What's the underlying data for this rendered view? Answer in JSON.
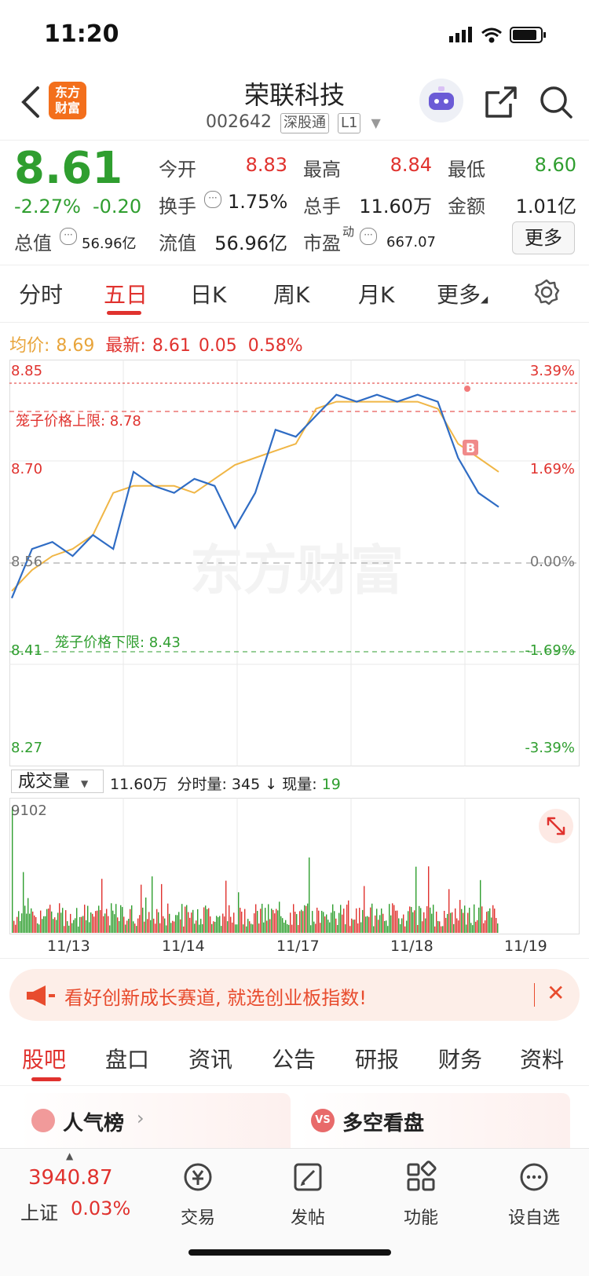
{
  "status_bar": {
    "time": "11:20"
  },
  "header": {
    "name": "荣联科技",
    "code": "002642",
    "tag1": "深股通",
    "tag2": "L1",
    "logo_line1": "东方",
    "logo_line2": "财富"
  },
  "quote": {
    "price": "8.61",
    "change_pct": "-2.27%",
    "change": "-0.20",
    "open_label": "今开",
    "open": "8.83",
    "high_label": "最高",
    "high": "8.84",
    "low_label": "最低",
    "low": "8.60",
    "turnover_label": "换手",
    "turnover": "1.75%",
    "volume_label": "总手",
    "volume": "11.60万",
    "amount_label": "金额",
    "amount": "1.01亿",
    "mktcap_label": "总值",
    "mktcap": "56.96亿",
    "float_label": "流值",
    "float": "56.96亿",
    "pe_label": "市盈",
    "pe_sup": "动",
    "pe": "667.07",
    "more": "更多"
  },
  "chart_tabs": [
    "分时",
    "五日",
    "日K",
    "周K",
    "月K",
    "更多"
  ],
  "chart_info": {
    "avg_label": "均价:",
    "avg": "8.69",
    "latest_label": "最新:",
    "latest": "8.61",
    "chg": "0.05",
    "pct": "0.58%"
  },
  "chart_labels": {
    "y_top": "8.85",
    "y_mid_up": "8.70",
    "y_base": "8.56",
    "y_low": "8.41",
    "y_bottom": "8.27",
    "p_top": "3.39%",
    "p_mid_up": "1.69%",
    "p_zero": "0.00%",
    "p_low": "-1.69%",
    "p_bottom": "-3.39%",
    "upper_limit": "笼子价格上限:  8.78",
    "lower_limit": "笼子价格下限:  8.43",
    "marker": "B",
    "watermark": "东方财富"
  },
  "volume": {
    "selector": "成交量",
    "total": "11.60万",
    "tick_label": "分时量:",
    "tick": "345",
    "arrow": "↓",
    "current_label": "现量:",
    "current": "19",
    "max": "9102"
  },
  "dates": [
    "11/13",
    "11/14",
    "11/17",
    "11/18",
    "11/19"
  ],
  "banner": {
    "text": "看好创新成长赛道, 就选创业板指数!"
  },
  "section_tabs": [
    "股吧",
    "盘口",
    "资讯",
    "公告",
    "研报",
    "财务",
    "资料"
  ],
  "cards": {
    "popularity": "人气榜",
    "bull_bear": "多空看盘"
  },
  "bottom_nav": {
    "index_value": "3940.87",
    "index_name": "上证",
    "index_pct": "0.03%",
    "trade": "交易",
    "post": "发帖",
    "function": "功能",
    "watchlist": "设自选"
  },
  "chart_data": {
    "type": "line",
    "title": "",
    "x": [
      "11/13",
      "11/14",
      "11/17",
      "11/18",
      "11/19"
    ],
    "price_range": [
      8.27,
      8.85
    ],
    "pct_range": [
      -3.39,
      3.39
    ],
    "prev_close": 8.56,
    "upper_limit": 8.78,
    "lower_limit": 8.43,
    "series": [
      {
        "name": "",
        "values": [
          8.51,
          8.58,
          8.59,
          8.57,
          8.6,
          8.58,
          8.69,
          8.67,
          8.66,
          8.68,
          8.67,
          8.61,
          8.66,
          8.75,
          8.74,
          8.77,
          8.8,
          8.79,
          8.8,
          8.79,
          8.8,
          8.79,
          8.71,
          8.66,
          8.64
        ]
      },
      {
        "name": "均价",
        "values": [
          8.52,
          8.55,
          8.57,
          8.58,
          8.6,
          8.66,
          8.67,
          8.67,
          8.67,
          8.66,
          8.68,
          8.7,
          8.71,
          8.72,
          8.73,
          8.78,
          8.79,
          8.79,
          8.79,
          8.79,
          8.79,
          8.78,
          8.73,
          8.71,
          8.69
        ]
      }
    ],
    "volume_max": 9102
  }
}
